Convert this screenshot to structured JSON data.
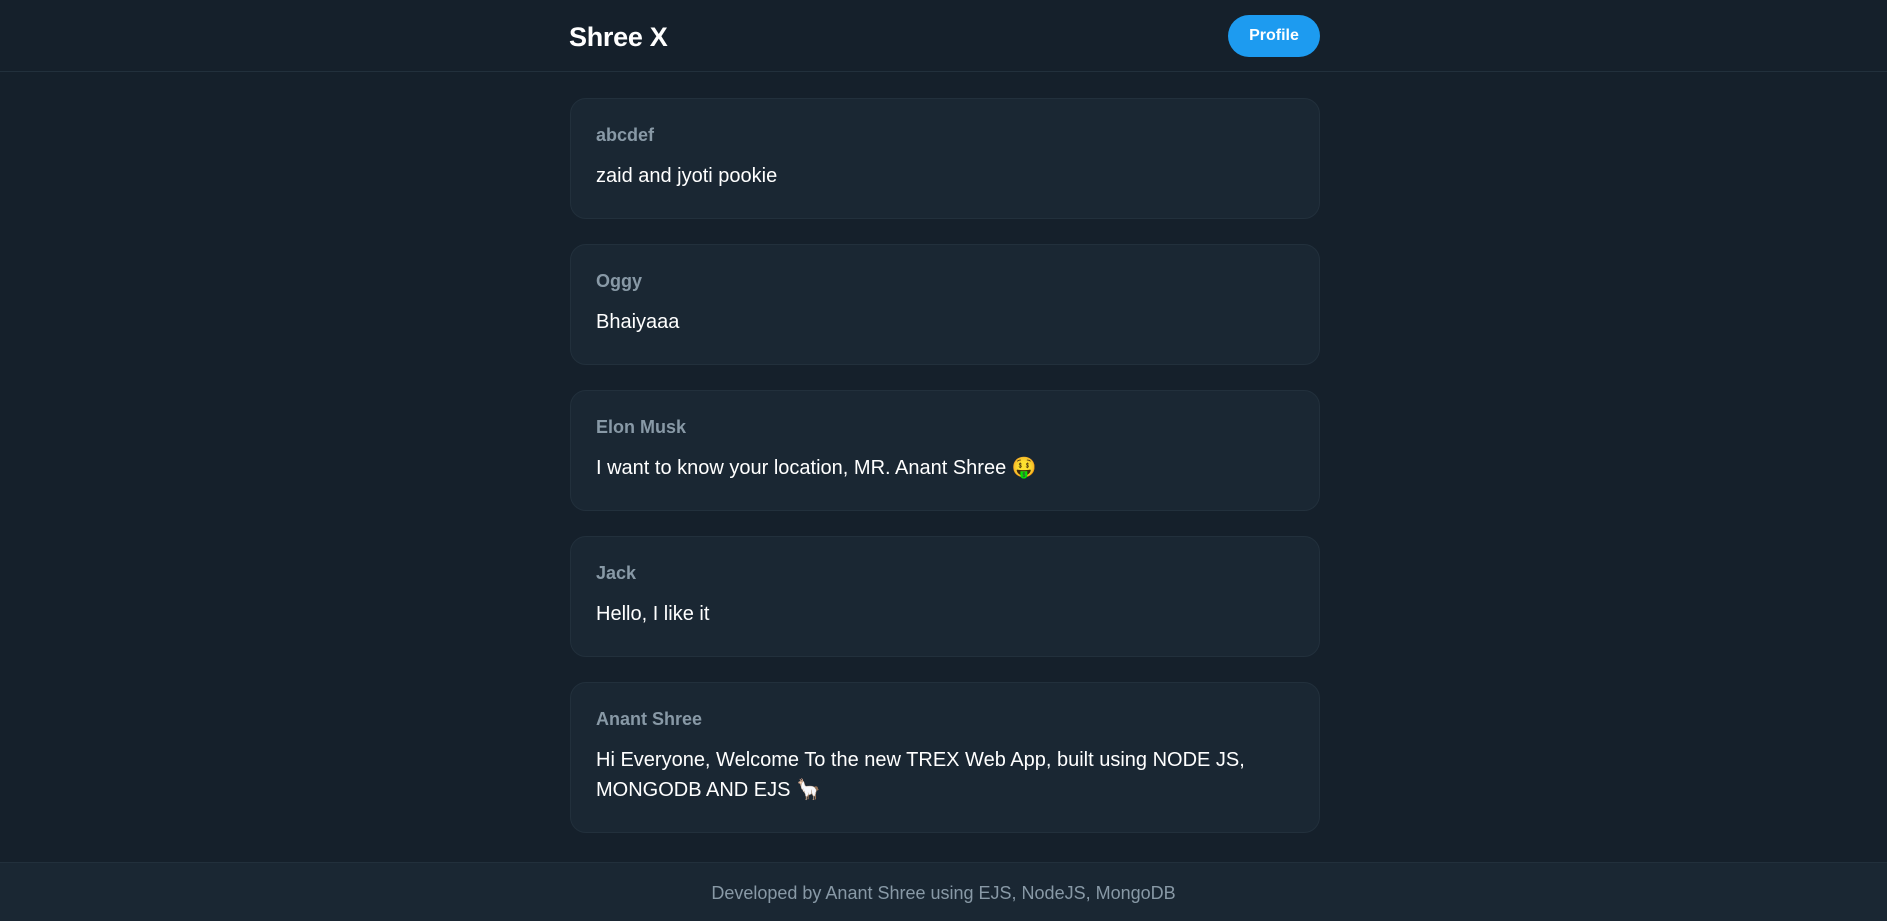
{
  "header": {
    "brand": "Shree X",
    "profile_label": "Profile"
  },
  "posts": [
    {
      "author": "abcdef",
      "content": "zaid and jyoti pookie"
    },
    {
      "author": "Oggy",
      "content": "Bhaiyaaa"
    },
    {
      "author": "Elon Musk",
      "content": "I want to know your location, MR. Anant Shree 🤑"
    },
    {
      "author": "Jack",
      "content": "Hello, I like it"
    },
    {
      "author": "Anant Shree",
      "content": "Hi Everyone, Welcome To the new TREX Web App, built using NODE JS, MONGODB AND EJS 🦙"
    }
  ],
  "footer": {
    "text": "Developed by Anant Shree using EJS, NodeJS, MongoDB"
  },
  "colors": {
    "background": "#15202b",
    "card": "#1a2733",
    "border": "#22303c",
    "accent": "#1d9bf0",
    "muted_text": "#8899a6",
    "primary_text": "#ffffff"
  }
}
